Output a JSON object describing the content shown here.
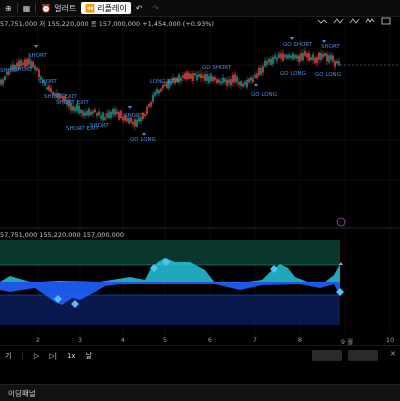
{
  "toolbar": {
    "alert_label": "얼러트",
    "replay_label": "리플레이",
    "icons": [
      "plus-square-icon",
      "grid-layout-icon",
      "alarm-clock-icon",
      "rewind-icon",
      "undo-icon",
      "redo-icon"
    ]
  },
  "ohlc_text": "57,751,000 저 155,220,000 종 157,000,000 +1,454,000 (+0.93%)",
  "indicator_text": "57,751,000 155,220,000 157,000,000",
  "x_ticks": [
    "2",
    "3",
    "4",
    "5",
    "6",
    "7",
    "8",
    "9 월",
    "10"
  ],
  "signals": {
    "short_label": "SHORT",
    "long_label": "GO LONG",
    "go_short_label": "GO SHORT",
    "short_exit_label": "SHORT EXIT",
    "long_exit_label": "LONG EXIT"
  },
  "bottom_bar": {
    "left_label": "기",
    "speed_label": "1x",
    "day_label": "날"
  },
  "panel": {
    "label": "이딩패널"
  },
  "colors": {
    "up": "#26a69a",
    "down": "#ef5350",
    "signal": "#4d8fe0",
    "osc_up": "#26c6da",
    "osc_down": "#1e62ff"
  }
}
